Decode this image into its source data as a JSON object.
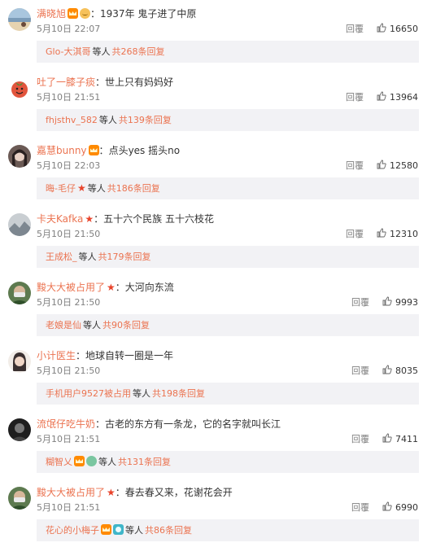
{
  "comments": [
    {
      "author": "满晓旭",
      "badges": [
        "crown",
        "cat"
      ],
      "star": false,
      "text": "1937年 鬼子进了中原",
      "time": "5月10日 22:07",
      "reply_label": "回覆",
      "likes": "16650",
      "reply_user": "Glo-大淇哥",
      "reply_badges": [],
      "reply_star": false,
      "reply_mid": "等人",
      "reply_count": "共268条回复",
      "avatar": {
        "icon": "beach-avatar",
        "bg": "#e6d3b0",
        "fg": "#7b9bb8"
      }
    },
    {
      "author": "吐了一膝子痰",
      "badges": [],
      "star": false,
      "text": "世上只有妈妈好",
      "time": "5月10日 21:51",
      "reply_label": "回覆",
      "likes": "13964",
      "reply_user": "fhjsthv_582",
      "reply_badges": [],
      "reply_star": false,
      "reply_mid": "等人",
      "reply_count": "共139条回复",
      "avatar": {
        "icon": "tomato-avatar",
        "bg": "#ffffff",
        "fg": "#e2553d"
      }
    },
    {
      "author": "嘉慧bunny",
      "badges": [
        "crown"
      ],
      "star": false,
      "text": "点头yes 摇头no",
      "time": "5月10日 22:03",
      "reply_label": "回覆",
      "likes": "12580",
      "reply_user": "晦-毛仔",
      "reply_badges": [],
      "reply_star": true,
      "reply_mid": "等人",
      "reply_count": "共186条回复",
      "avatar": {
        "icon": "girl-avatar",
        "bg": "#6b5a55",
        "fg": "#e8d0c4"
      }
    },
    {
      "author": "卡夫Kafka",
      "badges": [],
      "star": true,
      "text": "五十六个民族 五十六枝花",
      "time": "5月10日 21:50",
      "reply_label": "回覆",
      "likes": "12310",
      "reply_user": "王成松_",
      "reply_badges": [],
      "reply_star": false,
      "reply_mid": "等人",
      "reply_count": "共179条回复",
      "avatar": {
        "icon": "landscape-avatar",
        "bg": "#c9ced2",
        "fg": "#7d8790"
      }
    },
    {
      "author": "黢大大被占用了",
      "badges": [],
      "star": true,
      "text": "大河向东流",
      "time": "5月10日 21:50",
      "reply_label": "回覆",
      "likes": "9993",
      "reply_user": "老娘是仙",
      "reply_badges": [],
      "reply_star": false,
      "reply_mid": "等人",
      "reply_count": "共90条回复",
      "avatar": {
        "icon": "masked-man-avatar",
        "bg": "#5d7a4f",
        "fg": "#eaeaea"
      }
    },
    {
      "author": "小计医生",
      "badges": [],
      "star": false,
      "text": "地球自转一圈是一年",
      "time": "5月10日 21:50",
      "reply_label": "回覆",
      "likes": "8035",
      "reply_user": "手机用户9527被占用",
      "reply_badges": [],
      "reply_star": false,
      "reply_mid": "等人",
      "reply_count": "共198条回复",
      "avatar": {
        "icon": "woman-avatar",
        "bg": "#f2ede8",
        "fg": "#3a3030"
      }
    },
    {
      "author": "流氓仔吃牛奶",
      "badges": [],
      "star": false,
      "text": "古老的东方有一条龙，它的名字就叫长江",
      "time": "5月10日 21:51",
      "reply_label": "回覆",
      "likes": "7411",
      "reply_user": "糊智乂",
      "reply_badges": [
        "crown",
        "green"
      ],
      "reply_star": false,
      "reply_mid": "等人",
      "reply_count": "共131条回复",
      "avatar": {
        "icon": "dark-portrait-avatar",
        "bg": "#1e1e1e",
        "fg": "#777777"
      }
    },
    {
      "author": "黢大大被占用了",
      "badges": [],
      "star": true,
      "text": "春去春又来，花谢花会开",
      "time": "5月10日 21:51",
      "reply_label": "回覆",
      "likes": "6990",
      "reply_user": "花心的小梅子",
      "reply_badges": [
        "crown",
        "teal"
      ],
      "reply_star": false,
      "reply_mid": "等人",
      "reply_count": "共86条回复",
      "avatar": {
        "icon": "masked-man-avatar",
        "bg": "#5d7a4f",
        "fg": "#eaeaea"
      }
    }
  ],
  "colors": {
    "username": "#eb7350",
    "body_text": "#333333",
    "meta_text": "#808080",
    "reply_box_bg": "#f2f2f5",
    "star": "#e8432b"
  }
}
